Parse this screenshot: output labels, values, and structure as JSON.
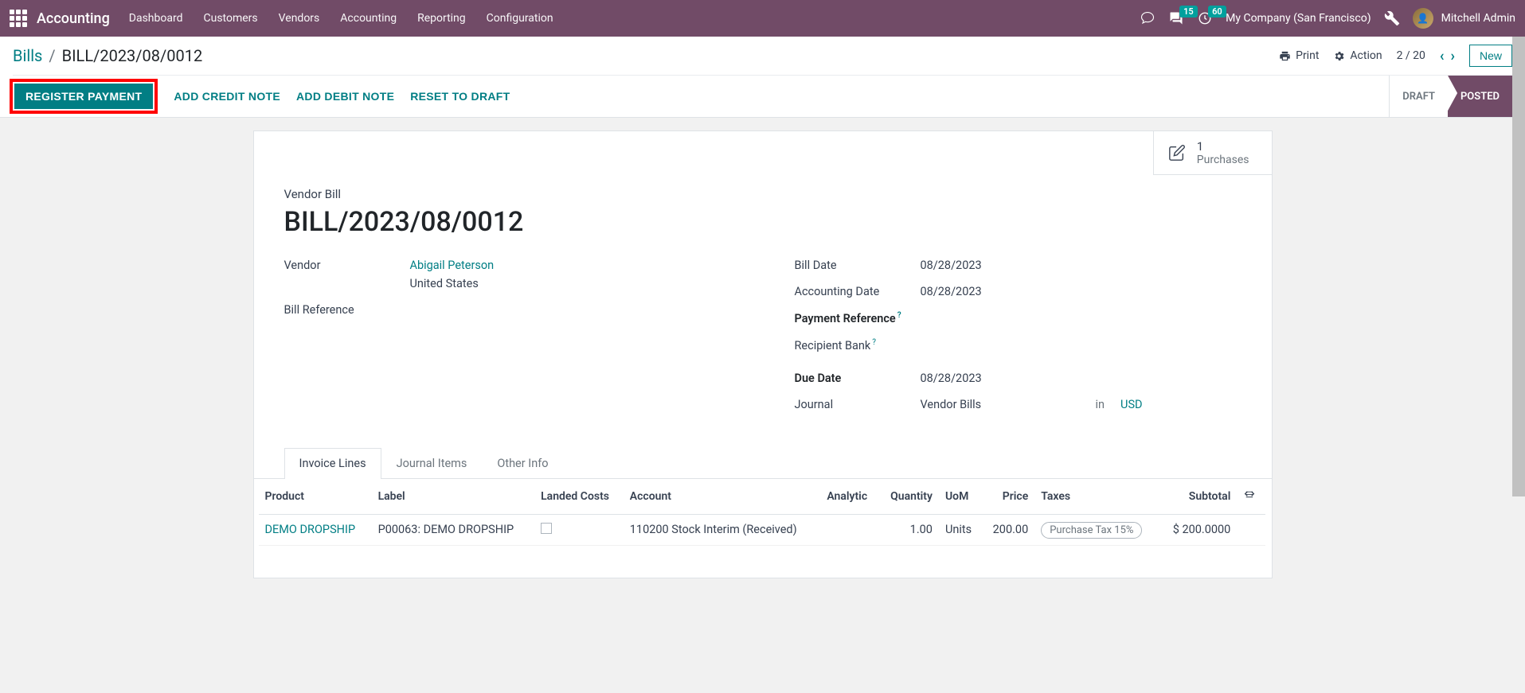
{
  "navbar": {
    "brand": "Accounting",
    "menu": [
      "Dashboard",
      "Customers",
      "Vendors",
      "Accounting",
      "Reporting",
      "Configuration"
    ],
    "messages_badge": "15",
    "activities_badge": "60",
    "company": "My Company (San Francisco)",
    "user": "Mitchell Admin"
  },
  "breadcrumb": {
    "root": "Bills",
    "current": "BILL/2023/08/0012"
  },
  "cp": {
    "print": "Print",
    "action": "Action",
    "pager": "2 / 20",
    "new_btn": "New"
  },
  "actions": {
    "register_payment": "REGISTER PAYMENT",
    "add_credit": "ADD CREDIT NOTE",
    "add_debit": "ADD DEBIT NOTE",
    "reset": "RESET TO DRAFT"
  },
  "status": {
    "draft": "DRAFT",
    "posted": "POSTED"
  },
  "stat": {
    "count": "1",
    "label": "Purchases"
  },
  "form": {
    "heading_small": "Vendor Bill",
    "title": "BILL/2023/08/0012",
    "labels": {
      "vendor": "Vendor",
      "bill_ref": "Bill Reference",
      "bill_date": "Bill Date",
      "acc_date": "Accounting Date",
      "pay_ref": "Payment Reference",
      "recip_bank": "Recipient Bank",
      "due_date": "Due Date",
      "journal": "Journal",
      "in": "in"
    },
    "values": {
      "vendor_name": "Abigail Peterson",
      "vendor_country": "United States",
      "bill_date": "08/28/2023",
      "acc_date": "08/28/2023",
      "due_date": "08/28/2023",
      "journal": "Vendor Bills",
      "currency": "USD"
    }
  },
  "tabs": [
    "Invoice Lines",
    "Journal Items",
    "Other Info"
  ],
  "table": {
    "headers": {
      "product": "Product",
      "label": "Label",
      "landed": "Landed Costs",
      "account": "Account",
      "analytic": "Analytic",
      "qty": "Quantity",
      "uom": "UoM",
      "price": "Price",
      "taxes": "Taxes",
      "subtotal": "Subtotal"
    },
    "row": {
      "product": "DEMO DROPSHIP",
      "label": "P00063: DEMO DROPSHIP",
      "account": "110200 Stock Interim (Received)",
      "qty": "1.00",
      "uom": "Units",
      "price": "200.00",
      "tax": "Purchase Tax 15%",
      "subtotal": "$ 200.0000"
    }
  }
}
